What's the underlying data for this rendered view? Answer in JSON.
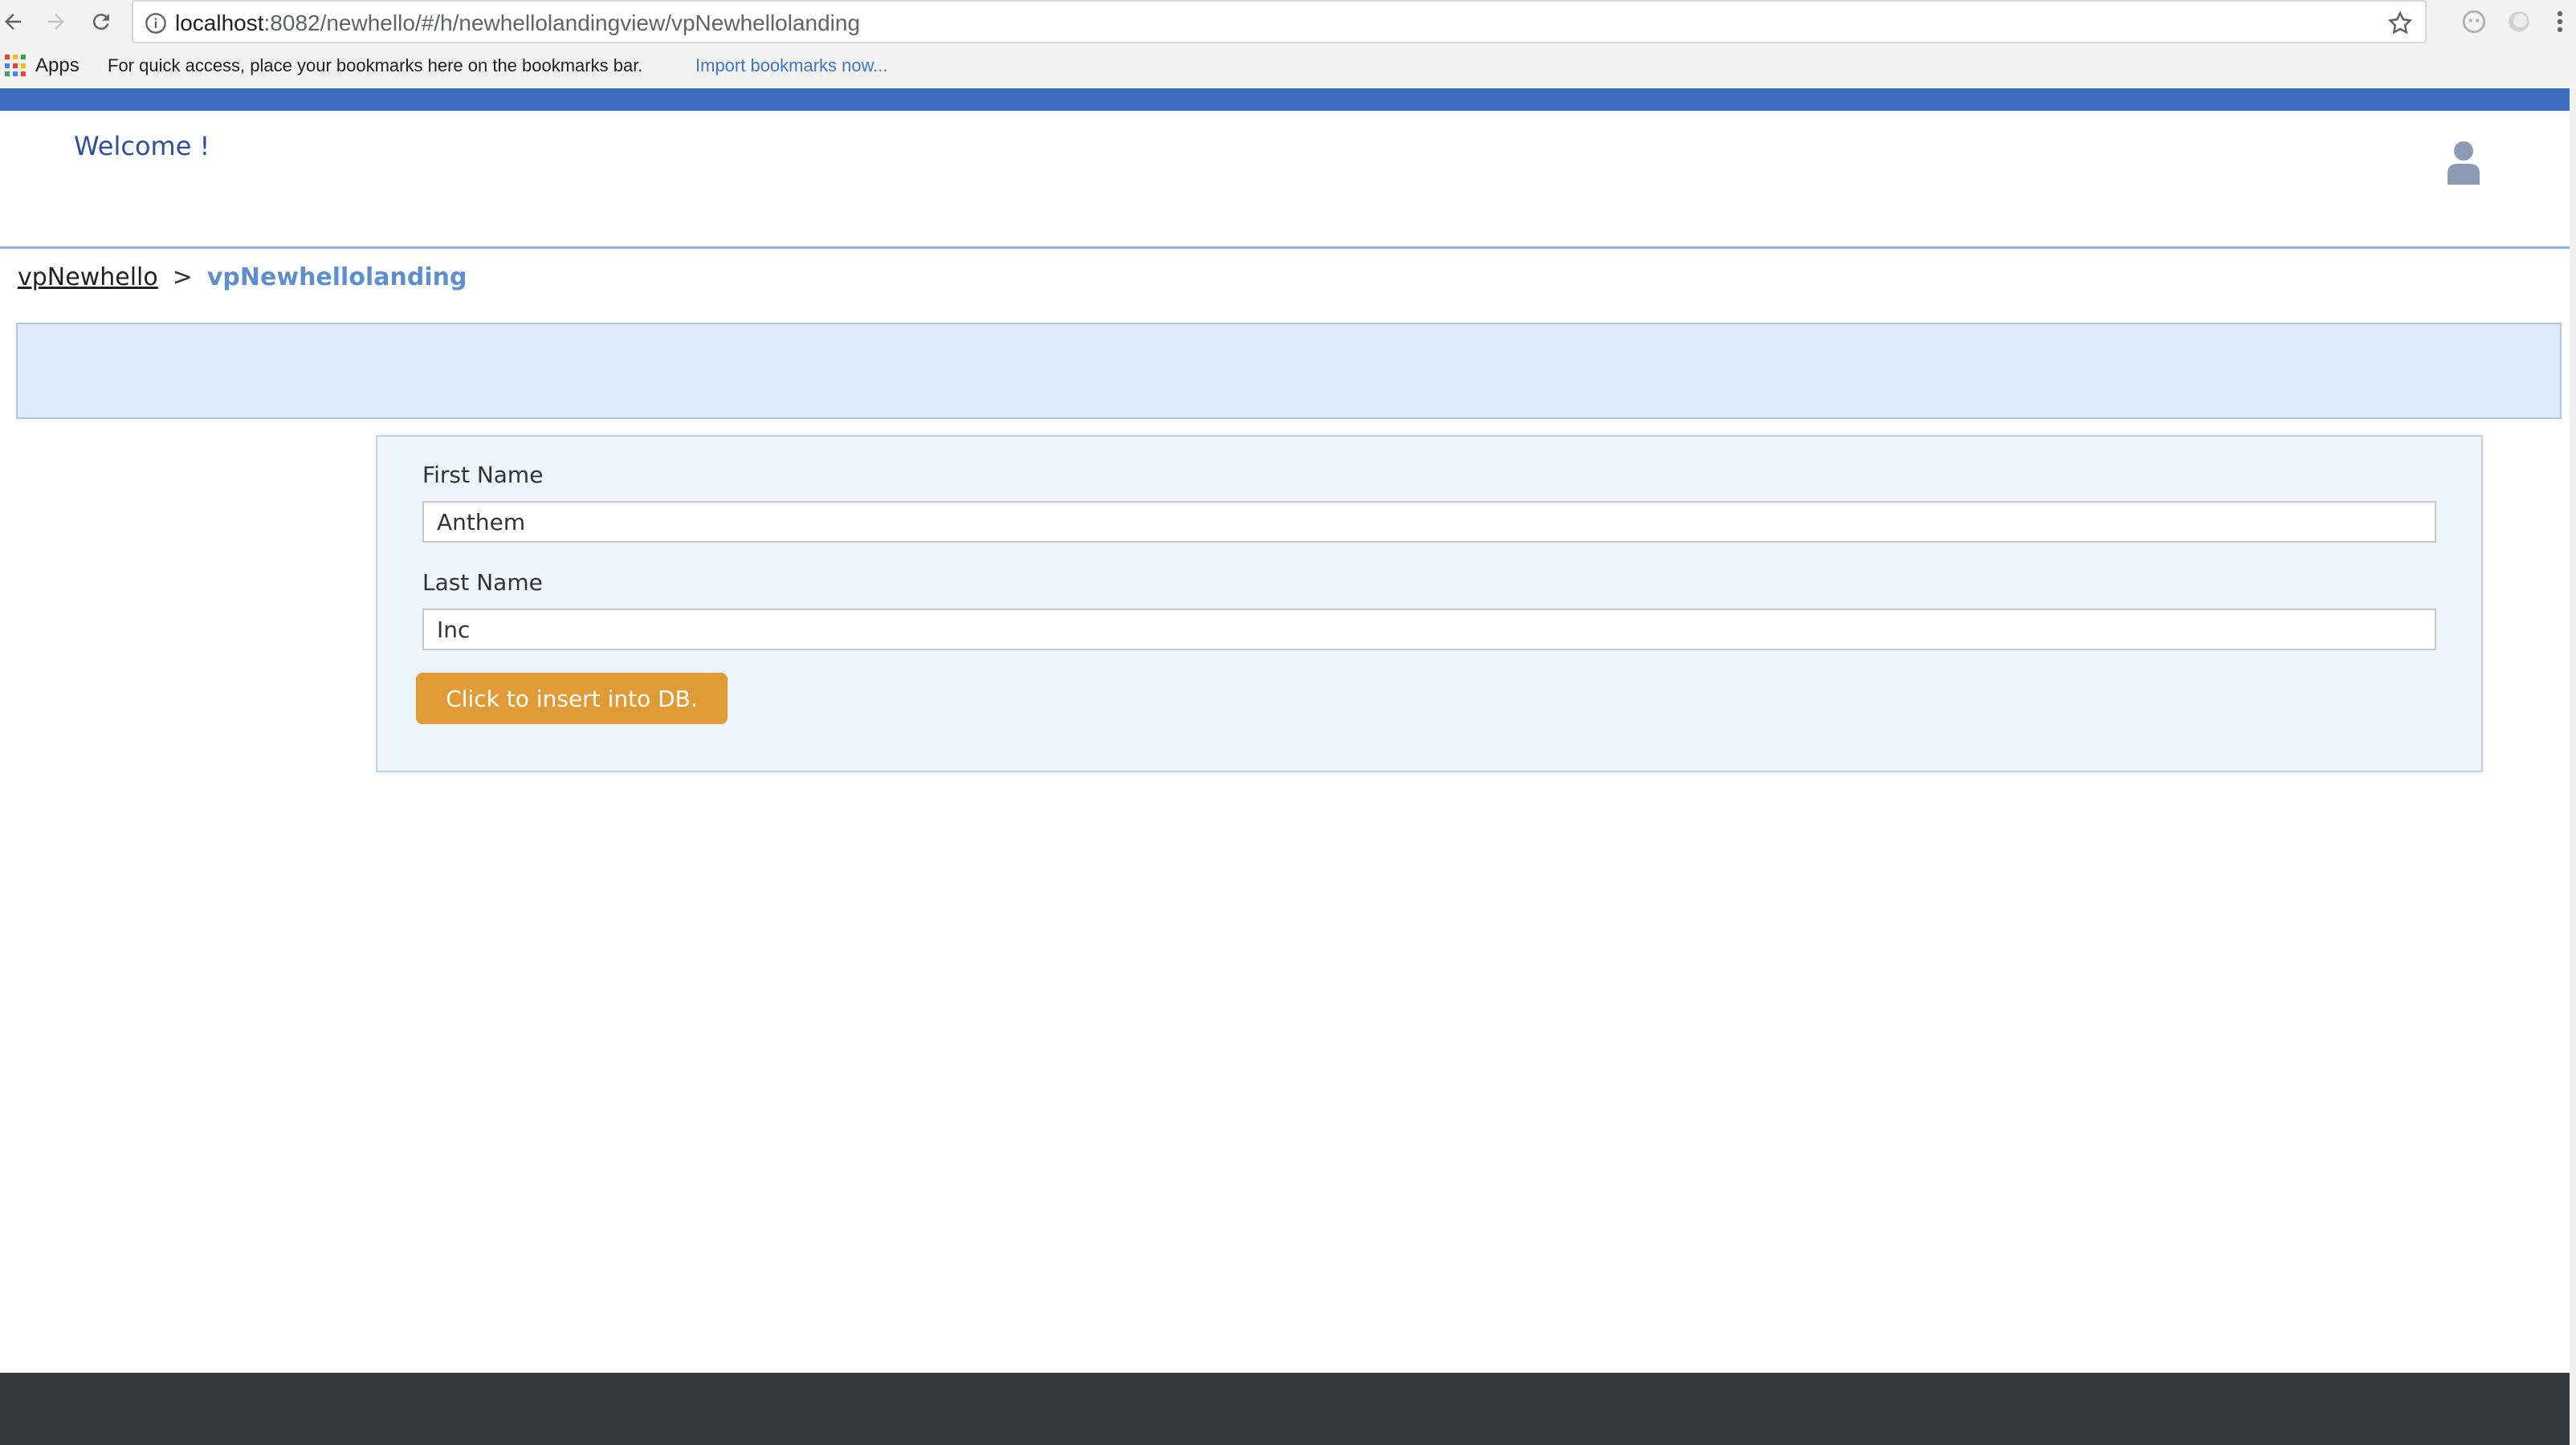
{
  "browser": {
    "url_host": "localhost",
    "url_rest": ":8082/newhello/#/h/newhellolandingview/vpNewhellolanding",
    "bookmarks": {
      "apps_label": "Apps",
      "hint": "For quick access, place your bookmarks here on the bookmarks bar.",
      "import_link": "Import bookmarks now..."
    },
    "icons": [
      "back-arrow-icon",
      "forward-arrow-icon",
      "reload-icon",
      "info-icon",
      "star-icon",
      "extension-icon",
      "menu-dots-icon"
    ]
  },
  "header": {
    "welcome": "Welcome !",
    "user_icon": "user-icon",
    "accent_color": "#3e6cc0"
  },
  "breadcrumb": {
    "parent": "vpNewhello",
    "separator": ">",
    "current": "vpNewhellolanding"
  },
  "form": {
    "first_name_label": "First Name",
    "first_name_value": "Anthem",
    "last_name_label": "Last Name",
    "last_name_value": "Inc",
    "submit_label": "Click to insert into DB.",
    "submit_color": "#e09a36"
  }
}
